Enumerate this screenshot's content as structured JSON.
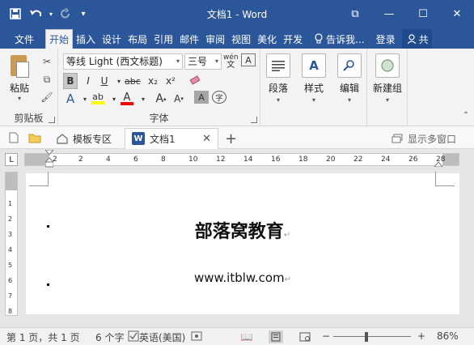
{
  "window": {
    "title": "文档1 - Word",
    "minimize_label": "—",
    "maximize_label": "☐",
    "close_label": "✕",
    "restore_label": "⧉"
  },
  "qat": {
    "save_icon": "save-icon",
    "undo_icon": "undo-icon",
    "redo_icon": "redo-icon",
    "customize_icon": "customize-qat-icon"
  },
  "tabs": [
    {
      "label": "文件"
    },
    {
      "label": "开始"
    },
    {
      "label": "插入"
    },
    {
      "label": "设计"
    },
    {
      "label": "布局"
    },
    {
      "label": "引用"
    },
    {
      "label": "邮件"
    },
    {
      "label": "审阅"
    },
    {
      "label": "视图"
    },
    {
      "label": "美化"
    },
    {
      "label": "开发"
    }
  ],
  "tellme": "告诉我...",
  "login": "登录",
  "share": "共",
  "clipboard": {
    "paste": "粘贴",
    "group": "剪贴板"
  },
  "font": {
    "name": "等线 Light (西文标题)",
    "size": "三号",
    "phonetic": "wén",
    "bold": "B",
    "italic": "I",
    "underline": "U",
    "strike": "abc",
    "subscript": "x₂",
    "superscript": "x²",
    "text_effect": "A",
    "highlight": "ab",
    "font_color": "A",
    "grow": "A",
    "shrink": "A",
    "char_shading": "A",
    "enclose": "字",
    "group": "字体"
  },
  "groups": {
    "paragraph": "段落",
    "styles": "样式",
    "editing": "编辑",
    "new_group": "新建组"
  },
  "doctabs": {
    "template": "模板专区",
    "doc": "文档1",
    "doc_icon": "W",
    "add": "+",
    "multi": "显示多窗口"
  },
  "ruler": {
    "h_ticks": [
      "2",
      "2",
      "4",
      "6",
      "8",
      "10",
      "12",
      "14",
      "16",
      "18",
      "20",
      "22",
      "24",
      "26",
      "28"
    ],
    "v_ticks": [
      "1",
      "2",
      "3",
      "4",
      "5",
      "6",
      "7",
      "8"
    ]
  },
  "document": {
    "title": "部落窝教育",
    "url": "www.itblw.com",
    "paragraph_mark": "↵"
  },
  "status": {
    "page": "第 1 页，共 1 页",
    "words": "6 个字",
    "language": "英语(美国)",
    "zoom": "86%",
    "zoom_minus": "−",
    "zoom_plus": "+",
    "zoom_level_fraction": 0.86
  },
  "colors": {
    "brand": "#2b579a",
    "highlight": "#ffff00",
    "font_color": "#ff0000"
  }
}
